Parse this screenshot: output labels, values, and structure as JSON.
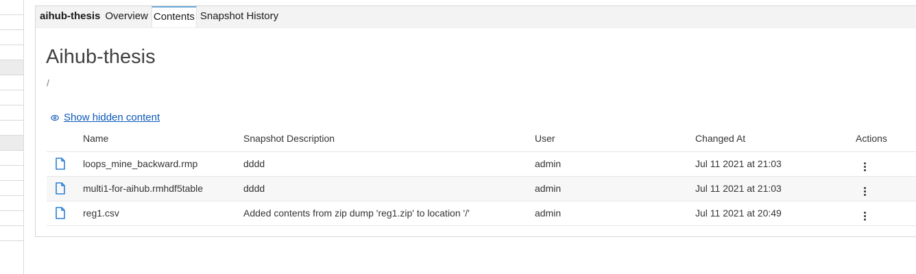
{
  "tabs": [
    {
      "label": "aihub-thesis",
      "bold": true,
      "active": false
    },
    {
      "label": "Overview",
      "bold": false,
      "active": false
    },
    {
      "label": "Contents",
      "bold": false,
      "active": true
    },
    {
      "label": "Snapshot History",
      "bold": false,
      "active": false
    }
  ],
  "page": {
    "title": "Aihub-thesis",
    "path": "/",
    "show_hidden_label": "Show hidden content"
  },
  "table": {
    "columns": [
      "Name",
      "Snapshot Description",
      "User",
      "Changed At",
      "Actions"
    ],
    "rows": [
      {
        "name": "loops_mine_backward.rmp",
        "description": "dddd",
        "user": "admin",
        "changed_at": "Jul 11 2021 at 21:03"
      },
      {
        "name": "multi1-for-aihub.rmhdf5table",
        "description": "dddd",
        "user": "admin",
        "changed_at": "Jul 11 2021 at 21:03"
      },
      {
        "name": "reg1.csv",
        "description": "Added contents from zip dump 'reg1.zip' to location '/'",
        "user": "admin",
        "changed_at": "Jul 11 2021 at 20:49"
      }
    ]
  },
  "icons": {
    "file": "file-icon",
    "eye": "eye-icon",
    "actions": "kebab-menu-icon"
  },
  "colors": {
    "link": "#0a57b8",
    "file_icon": "#2b7fd4",
    "active_tab_border": "#6aa9d9"
  }
}
